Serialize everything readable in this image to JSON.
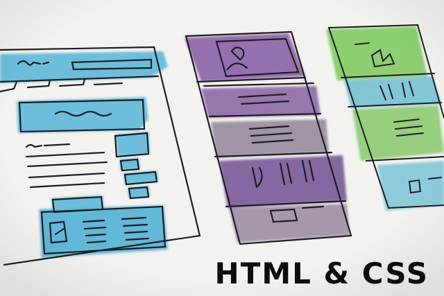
{
  "caption": "HTML & CSS",
  "colors": {
    "paper": "#f3f2ef",
    "blue_wash": "#4fb4d6",
    "purple_wash": "#8b63a8",
    "grey_purple_wash": "#8f8396",
    "green_wash": "#7bc95a",
    "ink": "#1e1c24"
  }
}
